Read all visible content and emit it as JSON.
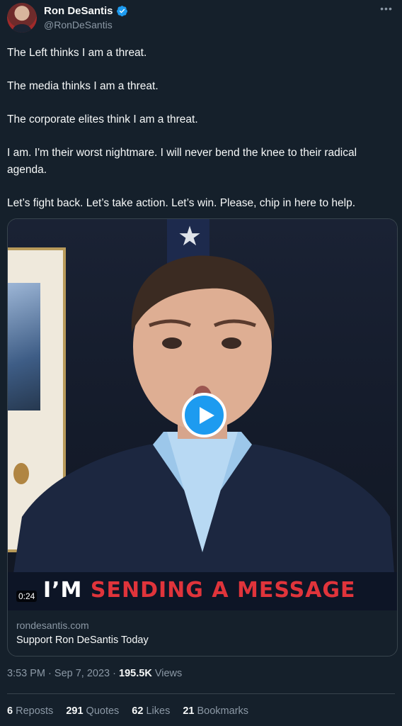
{
  "author": {
    "display_name": "Ron DeSantis",
    "handle": "@RonDeSantis"
  },
  "tweet": {
    "paragraphs": [
      "The Left thinks I am a threat.",
      "The media thinks I am a threat.",
      "The corporate elites think I am a threat.",
      "I am. I'm their worst nightmare. I will never bend the knee to their radical agenda.",
      "Let’s fight back. Let’s take action. Let’s win. Please, chip in here to help."
    ]
  },
  "card": {
    "banner_white": "I’M",
    "banner_red": "SENDING A MESSAGE",
    "duration": "0:24",
    "domain": "rondesantis.com",
    "title": "Support Ron DeSantis Today"
  },
  "meta": {
    "time": "3:53 PM",
    "separator": "·",
    "date": "Sep 7, 2023",
    "views_count": "195.5K",
    "views_label": "Views"
  },
  "stats": [
    {
      "count": "6",
      "label": "Reposts"
    },
    {
      "count": "291",
      "label": "Quotes"
    },
    {
      "count": "62",
      "label": "Likes"
    },
    {
      "count": "21",
      "label": "Bookmarks"
    }
  ],
  "icons": {
    "verified": "verified-badge-icon",
    "more": "more-icon",
    "play": "play-icon"
  },
  "colors": {
    "background": "#15202b",
    "accent": "#1d9bf0",
    "secondary_text": "#8b98a5",
    "banner_red": "#e0343b"
  }
}
